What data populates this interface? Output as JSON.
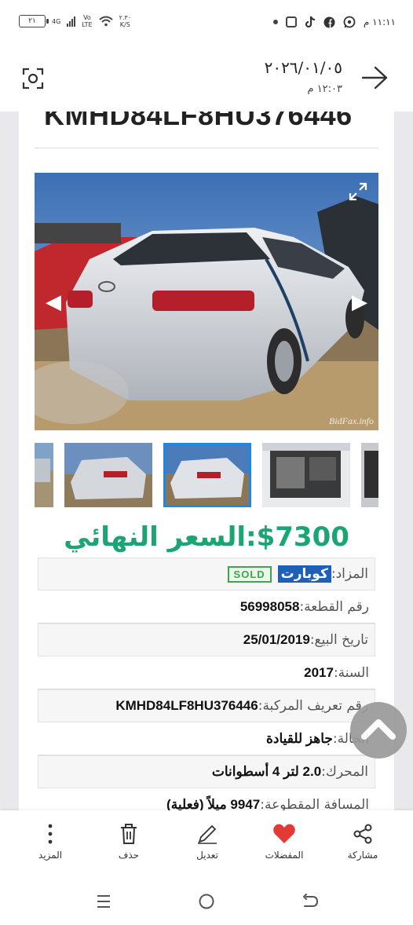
{
  "status_bar": {
    "time": "١١:١١ م",
    "battery": "٢١",
    "net_speed_value": "٢.٣٠",
    "net_speed_unit": "K/S",
    "network": "4G",
    "volte_top": "Vo",
    "volte_bottom": "LTE"
  },
  "header": {
    "date": "٢٠٢٦/٠١/٠٥",
    "time": "١٢:٠٣ م"
  },
  "listing": {
    "vin_heading": "KMHD84LF8HU376446",
    "watermark": "BidFax.info",
    "price_value": "$7300",
    "price_label": "السعر النهائي:",
    "details": [
      {
        "label": "المزاد:",
        "auction_name": "كوبارت",
        "badge": "SOLD"
      },
      {
        "label": "رقم القطعة:",
        "value": "56998058"
      },
      {
        "label": "تاريخ البيع:",
        "value": "25/01/2019"
      },
      {
        "label": "السنة:",
        "value": "2017"
      },
      {
        "label": "رقم تعريف المركبة:",
        "value": "KMHD84LF8HU376446"
      },
      {
        "label": "الحالة:",
        "value": "جاهز للقيادة"
      },
      {
        "label": "المحرك:",
        "value": "2.0 لتر 4 أسطوانات"
      },
      {
        "label": "المسافة المقطوعة:",
        "value": "9947 ميلاً (فعلية)"
      }
    ]
  },
  "toolbar": {
    "share": "مشاركة",
    "favorites": "المفضلات",
    "edit": "تعديل",
    "delete": "حذف",
    "more": "المزيد"
  },
  "colors": {
    "price_green": "#1aa572",
    "copart_blue": "#1e5fb8",
    "sold_green": "#3aa84a",
    "favorite_red": "#e53935"
  }
}
